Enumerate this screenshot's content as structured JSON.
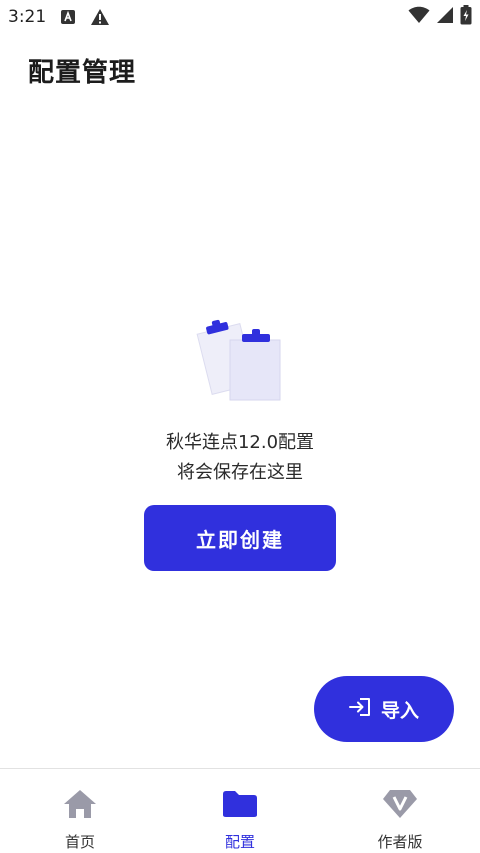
{
  "status_bar": {
    "time": "3:21",
    "icons": [
      "a-app-icon",
      "warning-icon"
    ],
    "right_icons": [
      "wifi-icon",
      "signal-icon",
      "battery-charging-icon"
    ]
  },
  "header": {
    "title": "配置管理"
  },
  "empty_state": {
    "icon": "clipboard-icon",
    "line1": "秋华连点12.0配置",
    "line2": "将会保存在这里",
    "create_button_label": "立即创建"
  },
  "fab": {
    "icon": "import-icon",
    "label": "导入"
  },
  "bottom_nav": {
    "items": [
      {
        "label": "首页",
        "icon": "home-icon",
        "active": false
      },
      {
        "label": "配置",
        "icon": "folder-icon",
        "active": true
      },
      {
        "label": "作者版",
        "icon": "diamond-v-icon",
        "active": false
      }
    ]
  },
  "colors": {
    "accent": "#3030dd",
    "inactive_icon": "#9a9aa8",
    "illustration_light": "#e8e8f8"
  }
}
